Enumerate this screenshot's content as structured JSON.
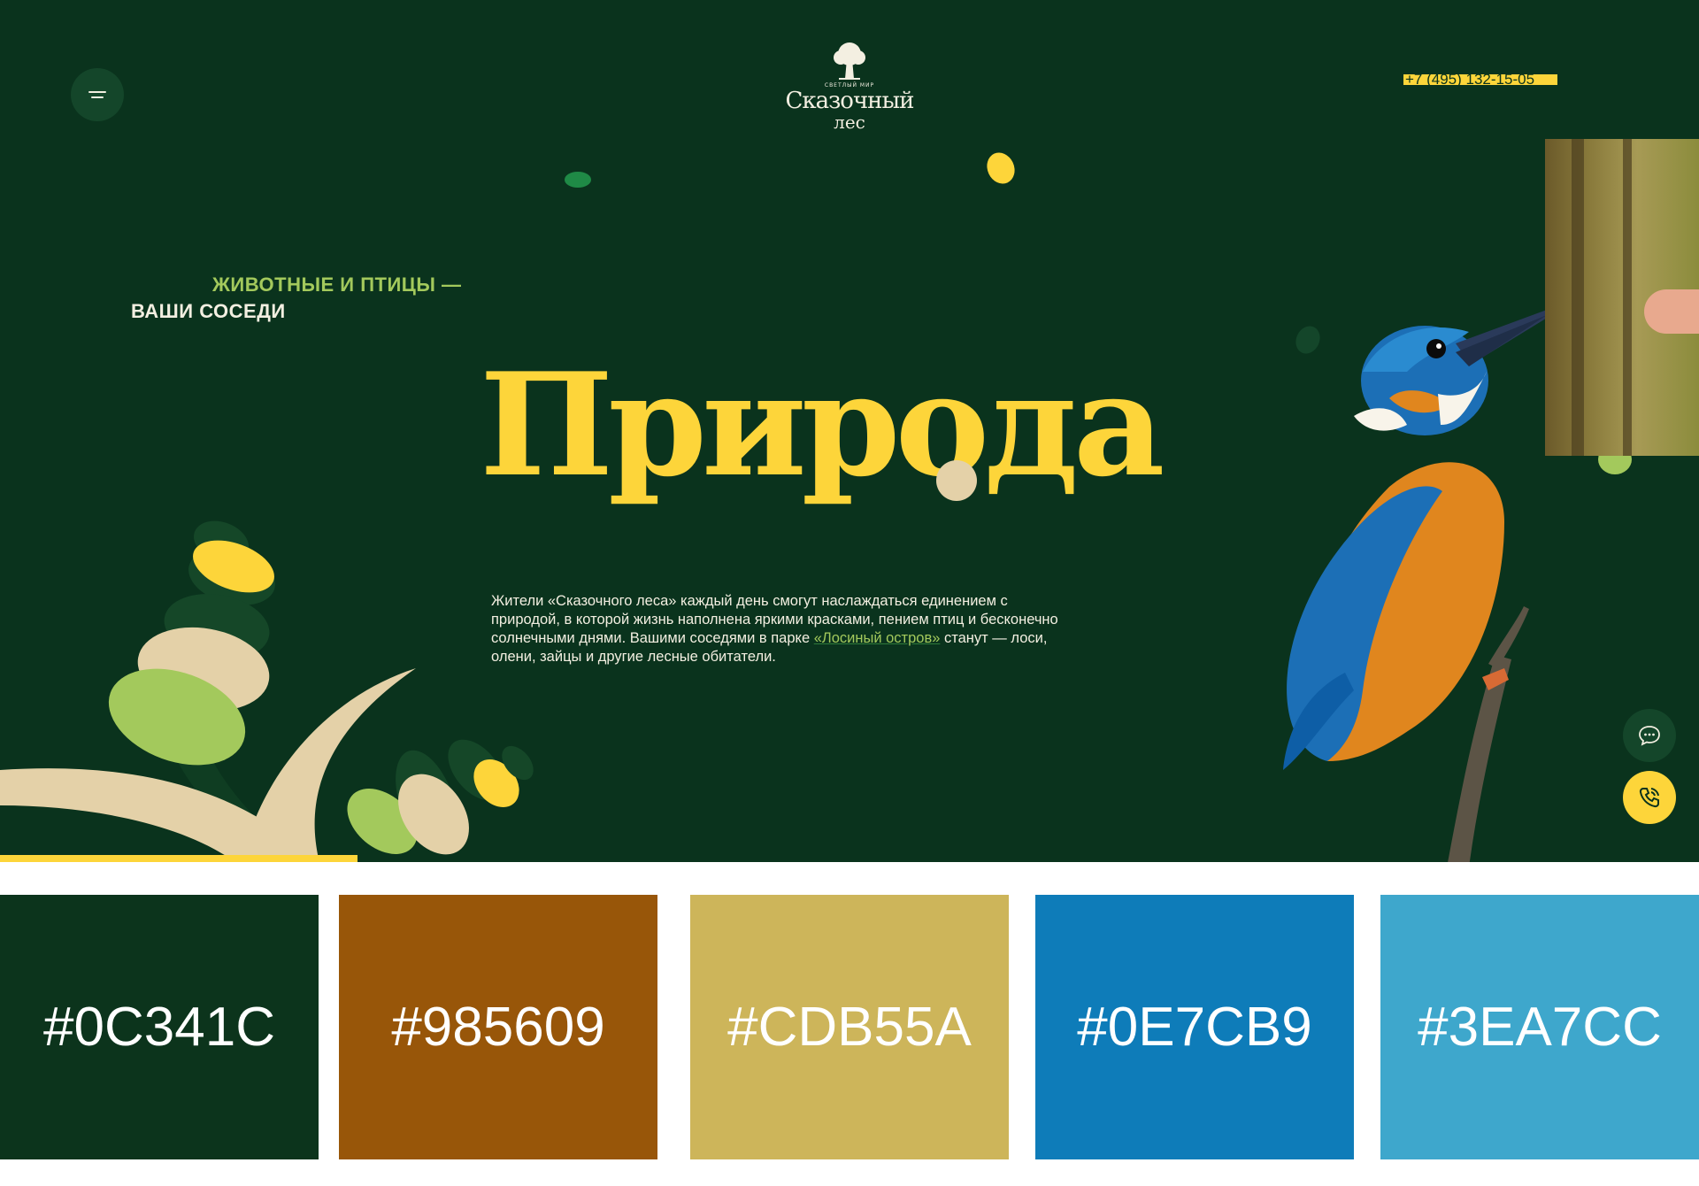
{
  "header": {
    "menu_icon": "hamburger-icon",
    "logo": {
      "small": "СВЕТЛЫЙ МИР",
      "line1": "Сказочный",
      "line2": "лес"
    },
    "phone": "+7 (495) 132-15-05"
  },
  "hero": {
    "eyebrow_line1": "ЖИВОТНЫЕ И ПТИЦЫ —",
    "eyebrow_line2": "ВАШИ СОСЕДИ",
    "headline": "Природа",
    "description_before": "Жители «Сказочного леса» каждый день смогут наслаждаться единением с природой, в которой жизнь наполнена яркими красками, пением птиц и бесконечно солнечными днями. Вашими соседями в парке ",
    "description_link": "«Лосиный остров»",
    "description_after": " станут — лоси, олени, зайцы и другие лесные обитатели."
  },
  "floating_buttons": {
    "chat_icon": "chat-bubble-icon",
    "call_icon": "phone-call-icon"
  },
  "colors": {
    "background": "#0a331d",
    "accent": "#fdd53a",
    "green_light": "#a3c95c",
    "cream": "#e4d1a8"
  },
  "palette": [
    {
      "hex": "#0C341C",
      "color": "#0C341C"
    },
    {
      "hex": "#985609",
      "color": "#985609"
    },
    {
      "hex": "#CDB55A",
      "color": "#CDB55A"
    },
    {
      "hex": "#0E7CB9",
      "color": "#0E7CB9"
    },
    {
      "hex": "#3EA7CC",
      "color": "#3EA7CC"
    }
  ]
}
